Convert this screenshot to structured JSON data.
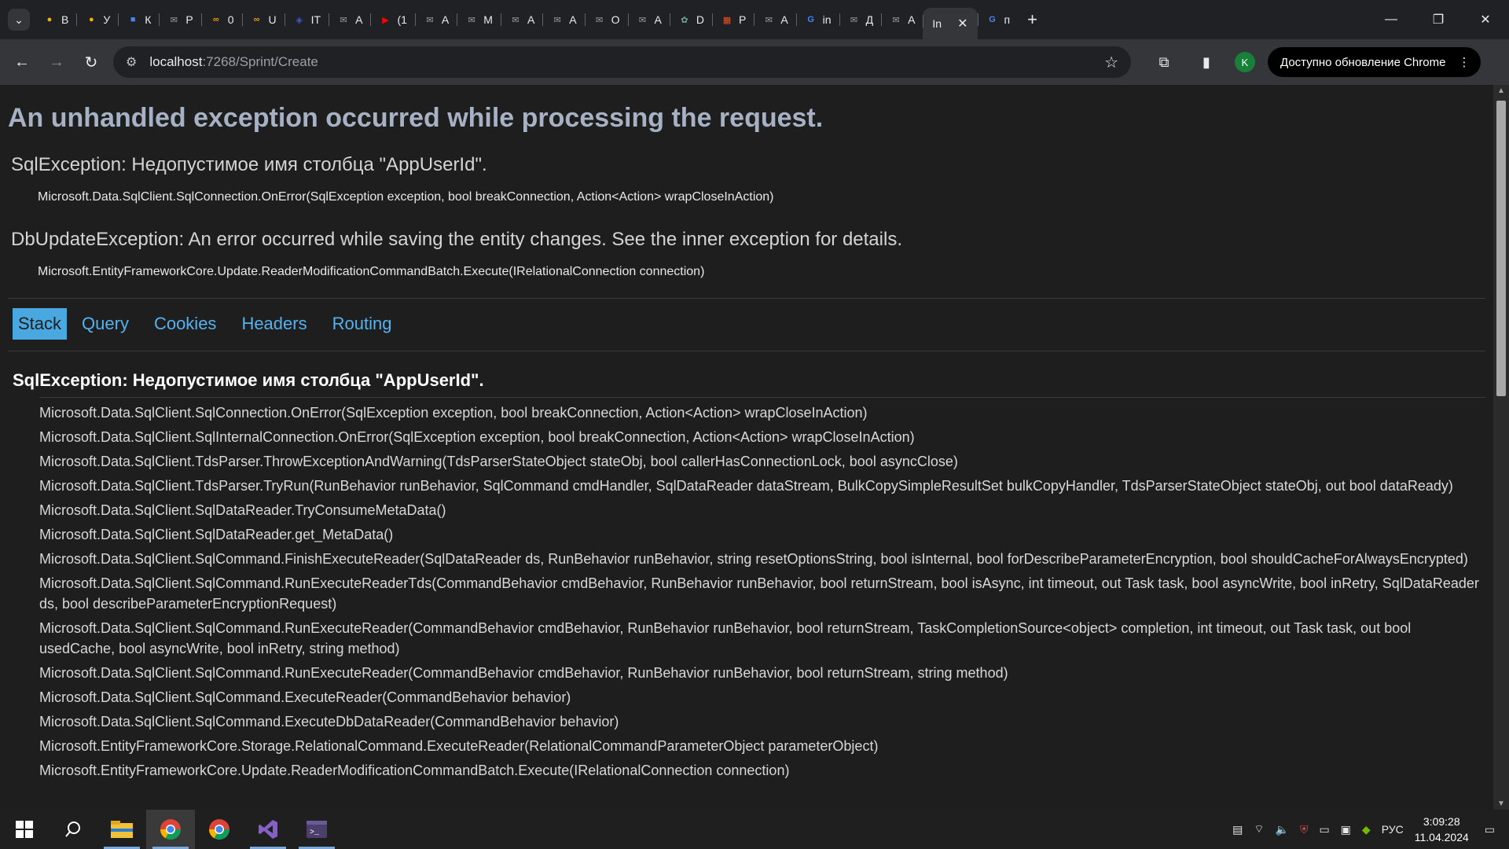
{
  "browser": {
    "tabs": [
      {
        "label": "В",
        "icon": "chrome-icon"
      },
      {
        "label": "У",
        "icon": "chrome-icon"
      },
      {
        "label": "К",
        "icon": "cube-icon"
      },
      {
        "label": "Р",
        "icon": "mail-icon"
      },
      {
        "label": "0",
        "icon": "loop-icon"
      },
      {
        "label": "U",
        "icon": "loop-icon"
      },
      {
        "label": "IT",
        "icon": "shield-icon"
      },
      {
        "label": "А",
        "icon": "mail-icon"
      },
      {
        "label": "(1",
        "icon": "youtube-icon"
      },
      {
        "label": "А",
        "icon": "mail-icon"
      },
      {
        "label": "М",
        "icon": "mail-icon"
      },
      {
        "label": "А",
        "icon": "mail-icon"
      },
      {
        "label": "А",
        "icon": "mail-icon"
      },
      {
        "label": "О",
        "icon": "mail-icon"
      },
      {
        "label": "А",
        "icon": "mail-icon"
      },
      {
        "label": "D",
        "icon": "openai-icon"
      },
      {
        "label": "Р",
        "icon": "microsoft-icon"
      },
      {
        "label": "А",
        "icon": "mail-icon"
      },
      {
        "label": "in",
        "icon": "google-icon"
      },
      {
        "label": "Д",
        "icon": "mail-icon"
      },
      {
        "label": "А",
        "icon": "mail-icon"
      }
    ],
    "active_tab": {
      "label": "In"
    },
    "after_tab": {
      "label": "п"
    },
    "url_host": "localhost",
    "url_path": ":7268/Sprint/Create",
    "profile_initial": "K",
    "update_label": "Доступно обновление Chrome"
  },
  "page": {
    "title": "An unhandled exception occurred while processing the request.",
    "exceptions": [
      {
        "title": "SqlException: Недопустимое имя столбца \"AppUserId\".",
        "location": "Microsoft.Data.SqlClient.SqlConnection.OnError(SqlException exception, bool breakConnection, Action<Action> wrapCloseInAction)"
      },
      {
        "title": "DbUpdateException: An error occurred while saving the entity changes. See the inner exception for details.",
        "location": "Microsoft.EntityFrameworkCore.Update.ReaderModificationCommandBatch.Execute(IRelationalConnection connection)"
      }
    ],
    "tabs": [
      "Stack",
      "Query",
      "Cookies",
      "Headers",
      "Routing"
    ],
    "stack_heading": "SqlException: Недопустимое имя столбца \"AppUserId\".",
    "stack_frames": [
      "Microsoft.Data.SqlClient.SqlConnection.OnError(SqlException exception, bool breakConnection, Action<Action> wrapCloseInAction)",
      "Microsoft.Data.SqlClient.SqlInternalConnection.OnError(SqlException exception, bool breakConnection, Action<Action> wrapCloseInAction)",
      "Microsoft.Data.SqlClient.TdsParser.ThrowExceptionAndWarning(TdsParserStateObject stateObj, bool callerHasConnectionLock, bool asyncClose)",
      "Microsoft.Data.SqlClient.TdsParser.TryRun(RunBehavior runBehavior, SqlCommand cmdHandler, SqlDataReader dataStream, BulkCopySimpleResultSet bulkCopyHandler, TdsParserStateObject stateObj, out bool dataReady)",
      "Microsoft.Data.SqlClient.SqlDataReader.TryConsumeMetaData()",
      "Microsoft.Data.SqlClient.SqlDataReader.get_MetaData()",
      "Microsoft.Data.SqlClient.SqlCommand.FinishExecuteReader(SqlDataReader ds, RunBehavior runBehavior, string resetOptionsString, bool isInternal, bool forDescribeParameterEncryption, bool shouldCacheForAlwaysEncrypted)",
      "Microsoft.Data.SqlClient.SqlCommand.RunExecuteReaderTds(CommandBehavior cmdBehavior, RunBehavior runBehavior, bool returnStream, bool isAsync, int timeout, out Task task, bool asyncWrite, bool inRetry, SqlDataReader ds, bool describeParameterEncryptionRequest)",
      "Microsoft.Data.SqlClient.SqlCommand.RunExecuteReader(CommandBehavior cmdBehavior, RunBehavior runBehavior, bool returnStream, TaskCompletionSource<object> completion, int timeout, out Task task, out bool usedCache, bool asyncWrite, bool inRetry, string method)",
      "Microsoft.Data.SqlClient.SqlCommand.RunExecuteReader(CommandBehavior cmdBehavior, RunBehavior runBehavior, bool returnStream, string method)",
      "Microsoft.Data.SqlClient.SqlCommand.ExecuteReader(CommandBehavior behavior)",
      "Microsoft.Data.SqlClient.SqlCommand.ExecuteDbDataReader(CommandBehavior behavior)",
      "Microsoft.EntityFrameworkCore.Storage.RelationalCommand.ExecuteReader(RelationalCommandParameterObject parameterObject)",
      "Microsoft.EntityFrameworkCore.Update.ReaderModificationCommandBatch.Execute(IRelationalConnection connection)"
    ]
  },
  "taskbar": {
    "apps": [
      "windows-start-icon",
      "search-icon",
      "file-explorer-icon",
      "chrome-icon",
      "chrome-icon",
      "visual-studio-icon",
      "terminal-icon"
    ],
    "language": "РУС",
    "time": "3:09:28",
    "date": "11.04.2024"
  },
  "colors": {
    "page_bg": "#1e1e1e",
    "heading": "#a6b1c4",
    "link": "#55b2f0",
    "active_tab_bg": "#4aa8e0"
  }
}
